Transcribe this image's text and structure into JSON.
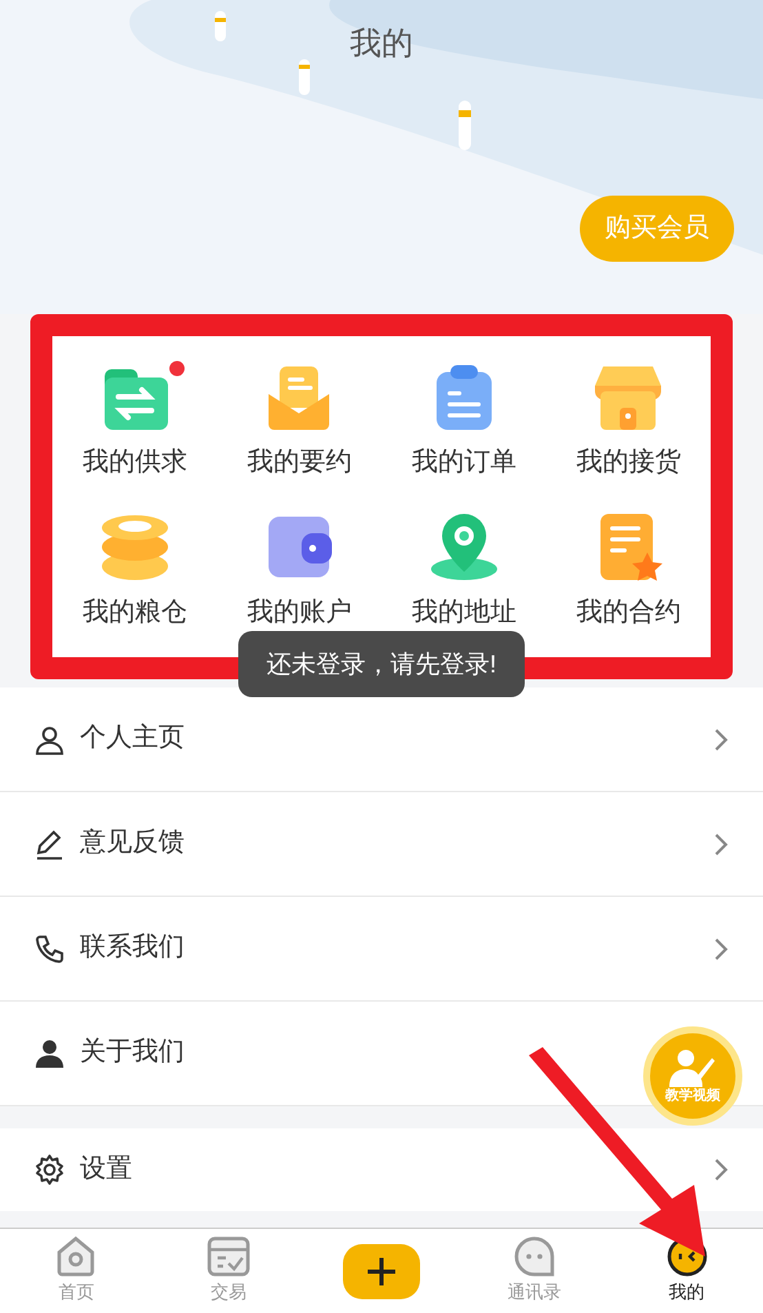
{
  "header": {
    "title": "我的",
    "vip_button": "购买会员"
  },
  "shortcuts": [
    {
      "label": "我的供求",
      "badge": true
    },
    {
      "label": "我的要约",
      "badge": false
    },
    {
      "label": "我的订单",
      "badge": false
    },
    {
      "label": "我的接货",
      "badge": false
    },
    {
      "label": "我的粮仓",
      "badge": false
    },
    {
      "label": "我的账户",
      "badge": false
    },
    {
      "label": "我的地址",
      "badge": false
    },
    {
      "label": "我的合约",
      "badge": false
    }
  ],
  "toast": "还未登录，请先登录!",
  "menu": [
    {
      "label": "个人主页"
    },
    {
      "label": "意见反馈"
    },
    {
      "label": "联系我们"
    },
    {
      "label": "关于我们"
    }
  ],
  "settings": {
    "label": "设置"
  },
  "tutorial_button": "教学视频",
  "tabbar": [
    {
      "label": "首页",
      "selected": false
    },
    {
      "label": "交易",
      "selected": false
    },
    {
      "kind": "add"
    },
    {
      "label": "通讯录",
      "selected": false
    },
    {
      "label": "我的",
      "selected": true
    }
  ]
}
